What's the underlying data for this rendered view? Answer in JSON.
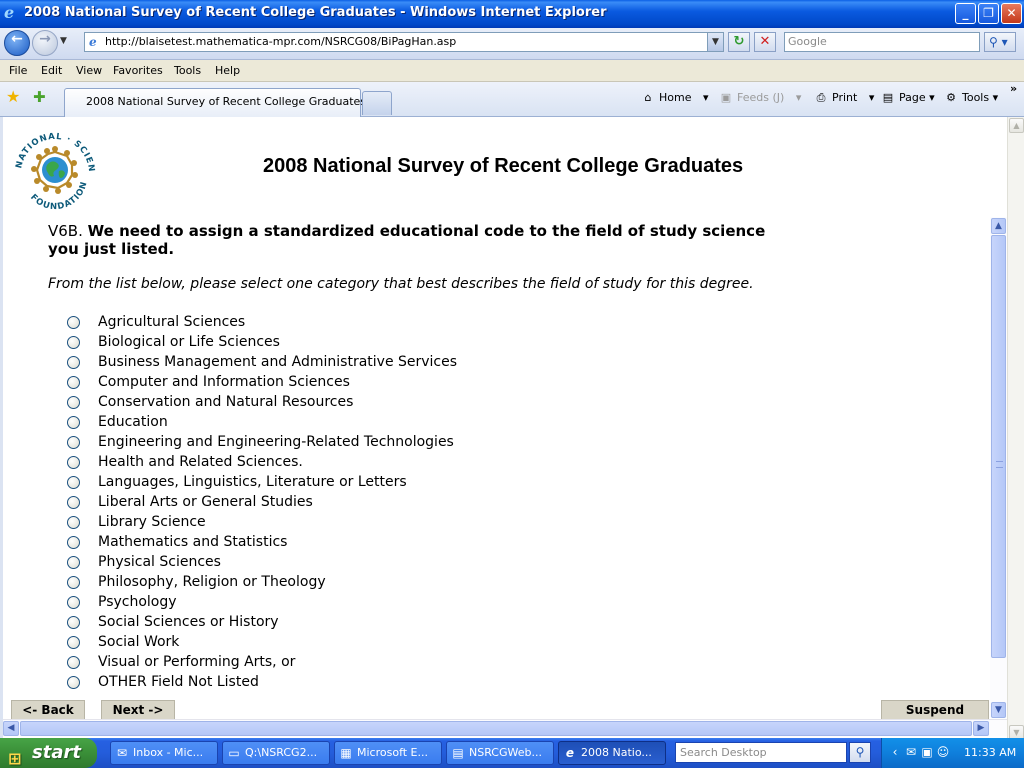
{
  "window": {
    "title": "2008 National Survey of Recent College Graduates - Windows Internet Explorer",
    "minimize": "_",
    "maximize": "❐",
    "close": "✕"
  },
  "toolbar": {
    "url": "http://blaisetest.mathematica-mpr.com/NSRCG08/BiPagHan.asp",
    "search_placeholder": "Google"
  },
  "menu": [
    "File",
    "Edit",
    "View",
    "Favorites",
    "Tools",
    "Help"
  ],
  "tabs": {
    "active_label": "2008 National Survey of Recent College Graduates"
  },
  "commands": {
    "home": "Home",
    "feeds": "Feeds (J)",
    "print": "Print",
    "page": "Page",
    "tools": "Tools"
  },
  "page": {
    "heading": "2008 National Survey of Recent College Graduates",
    "question_id": "V6B.",
    "question_text": "We need to assign a standardized educational code to the field of study science you just listed.",
    "instruction": "From the list below, please select one category that best describes the field of study for this degree.",
    "options": [
      "Agricultural Sciences",
      "Biological or Life Sciences",
      "Business Management and Administrative Services",
      "Computer and Information Sciences",
      "Conservation and Natural Resources",
      "Education",
      "Engineering and Engineering-Related Technologies",
      "Health and Related Sciences.",
      "Languages, Linguistics, Literature or Letters",
      "Liberal Arts or General Studies",
      "Library Science",
      "Mathematics and Statistics",
      "Physical Sciences",
      "Philosophy, Religion or Theology",
      "Psychology",
      "Social Sciences or History",
      "Social Work",
      "Visual or Performing Arts, or",
      "OTHER Field Not Listed"
    ],
    "back_label": "<- Back",
    "next_label": "Next ->",
    "suspend_label": "Suspend"
  },
  "taskbar": {
    "start": "start",
    "tasks": [
      {
        "label": "Inbox - Mic...",
        "icon": "outlook-icon"
      },
      {
        "label": "Q:\\NSRCG2...",
        "icon": "folder-icon"
      },
      {
        "label": "Microsoft E...",
        "icon": "excel-icon"
      },
      {
        "label": "NSRCGWeb...",
        "icon": "document-icon"
      },
      {
        "label": "2008 Natio...",
        "icon": "ie-icon"
      }
    ],
    "search_placeholder": "Search Desktop",
    "clock": "11:33 AM"
  }
}
